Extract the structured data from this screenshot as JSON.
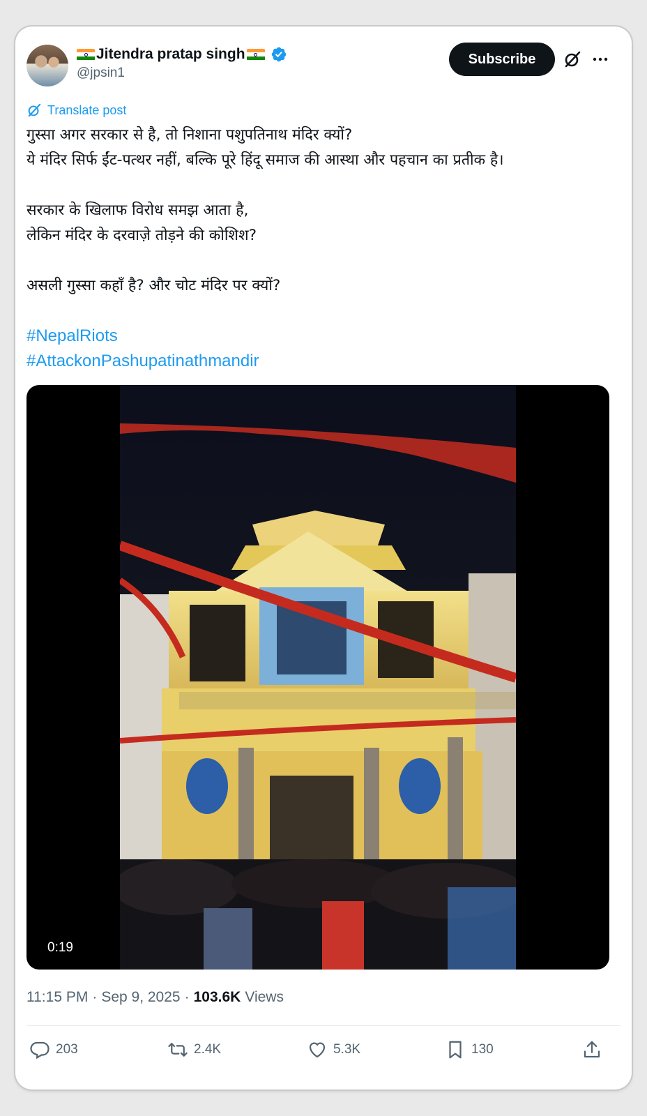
{
  "author": {
    "name": "Jitendra pratap singh",
    "handle": "@jpsin1",
    "verified": true
  },
  "header": {
    "subscribe_label": "Subscribe",
    "icons": [
      "grok-icon",
      "more-icon"
    ]
  },
  "translate_label": "Translate post",
  "text_lines": [
    "गुस्सा अगर सरकार से है, तो निशाना पशुपतिनाथ मंदिर क्यों?",
    "ये मंदिर सिर्फ ईंट-पत्थर नहीं, बल्कि पूरे हिंदू समाज की आस्था और पहचान का प्रतीक है।",
    "",
    "सरकार के खिलाफ विरोध समझ आता है,",
    "लेकिन मंदिर के दरवाज़े तोड़ने की कोशिश?",
    "",
    "असली गुस्सा कहाँ है? और चोट मंदिर पर क्यों?",
    ""
  ],
  "hashtags": [
    "#NepalRiots",
    "#AttackonPashupatinathmandir"
  ],
  "media": {
    "duration": "0:19"
  },
  "meta": {
    "time": "11:15 PM",
    "date": "Sep 9, 2025",
    "views_count": "103.6K",
    "views_label": "Views",
    "separator": "·"
  },
  "actions": {
    "replies": "203",
    "reposts": "2.4K",
    "likes": "5.3K",
    "bookmarks": "130"
  },
  "colors": {
    "link": "#1d9bf0",
    "muted": "#536471",
    "text": "#0f1419",
    "verified": "#1d9bf0"
  }
}
